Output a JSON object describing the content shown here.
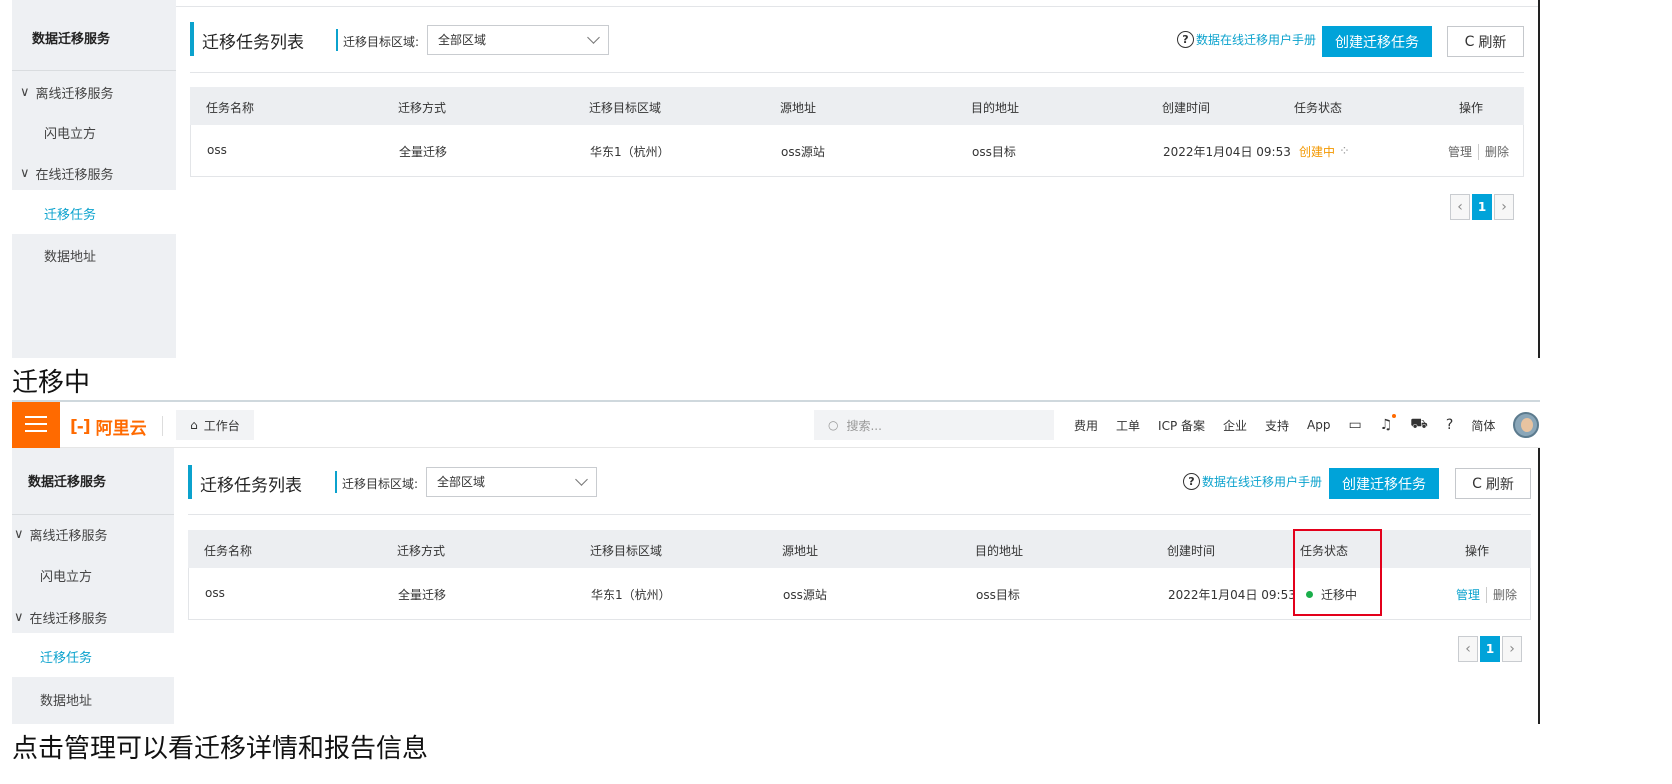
{
  "top": {
    "sidebar": {
      "title": "数据迁移服务",
      "groups": [
        {
          "label": "离线迁移服务",
          "items": [
            "闪电立方"
          ]
        },
        {
          "label": "在线迁移服务",
          "items": [
            "迁移任务",
            "数据地址"
          ]
        }
      ]
    },
    "header": {
      "title": "迁移任务列表",
      "region_label": "迁移目标区域:",
      "region_value": "全部区域",
      "help_icon": "?",
      "help_link": "数据在线迁移用户手册",
      "create_button": "创建迁移任务",
      "refresh_icon": "C",
      "refresh_button": "刷新"
    },
    "table": {
      "columns": [
        "任务名称",
        "迁移方式",
        "迁移目标区域",
        "源地址",
        "目的地址",
        "创建时间",
        "任务状态",
        "操作"
      ],
      "row": {
        "name": "oss",
        "method": "全量迁移",
        "region": "华东1（杭州）",
        "source": "oss源站",
        "destination": "oss目标",
        "created": "2022年1月04日 09:53",
        "status": "创建中",
        "status_icon": "⁘",
        "op_manage": "管理",
        "op_delete": "删除"
      }
    },
    "pager": {
      "prev": "‹",
      "current": "1",
      "next": "›"
    }
  },
  "mid_label": "迁移中",
  "bottom": {
    "topnav": {
      "logo_mark": "[-]",
      "logo_text": "阿里云",
      "home_icon": "⌂",
      "workbench": "工作台",
      "search_icon": "○",
      "search_placeholder": "搜索...",
      "items": [
        "费用",
        "工单",
        "ICP 备案",
        "企业",
        "支持",
        "App"
      ],
      "terminal_icon": "▭",
      "bell_icon": "♫",
      "cart_icon": "⛟",
      "help_icon": "?",
      "language": "简体"
    },
    "sidebar": {
      "title": "数据迁移服务",
      "groups": [
        {
          "label": "离线迁移服务",
          "items": [
            "闪电立方"
          ]
        },
        {
          "label": "在线迁移服务",
          "items": [
            "迁移任务",
            "数据地址"
          ]
        }
      ]
    },
    "header": {
      "title": "迁移任务列表",
      "region_label": "迁移目标区域:",
      "region_value": "全部区域",
      "help_icon": "?",
      "help_link": "数据在线迁移用户手册",
      "create_button": "创建迁移任务",
      "refresh_icon": "C",
      "refresh_button": "刷新"
    },
    "table": {
      "columns": [
        "任务名称",
        "迁移方式",
        "迁移目标区域",
        "源地址",
        "目的地址",
        "创建时间",
        "任务状态",
        "操作"
      ],
      "row": {
        "name": "oss",
        "method": "全量迁移",
        "region": "华东1（杭州）",
        "source": "oss源站",
        "destination": "oss目标",
        "created": "2022年1月04日 09:53",
        "status": "迁移中",
        "op_manage": "管理",
        "op_delete": "删除"
      }
    },
    "pager": {
      "prev": "‹",
      "current": "1",
      "next": "›"
    },
    "highlight_color": "#e3001b"
  },
  "bottom_caption": "点击管理可以看迁移详情和报告信息"
}
